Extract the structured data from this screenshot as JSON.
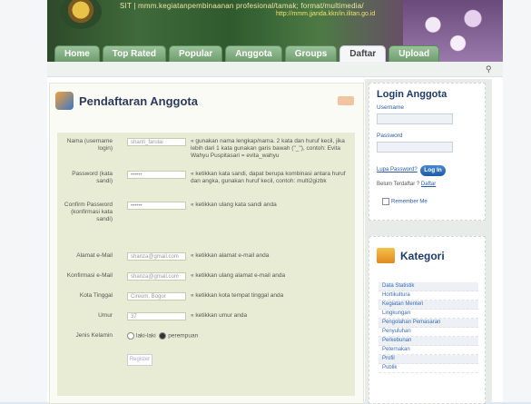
{
  "header": {
    "title": "SIT | mmm.kegiatanpembinaanan profesional/tamak; format/multimedia/",
    "url": "http://mmm.jjanda.kkn/in.ilitan.go.id"
  },
  "tabs": [
    "Home",
    "Top Rated",
    "Popular",
    "Anggota",
    "Groups",
    "Daftar",
    "Upload"
  ],
  "active_tab": "Daftar",
  "main": {
    "title": "Pendaftaran Anggota",
    "form": [
      {
        "label": "Nama (username login)",
        "value": "shanti_farulai",
        "hint": "« gunakan nama lengkap/nama. 2 kata dan huruf kecil, jika lebih dari 1 kata gunakan garis bawah (\"_\"), contoh: Evita Wahyu Puspitasari = evita_wahyu"
      },
      {
        "label": "Password (kata sandi)",
        "value": "••••••",
        "hint": "« ketikkan kata sandi, dapat berupa kombinasi antara huruf dan angka, gunakan huruf kecil, contoh: multi2gizbk"
      },
      {
        "label": "Confirm Password (konfirmasi kata sandi)",
        "value": "••••••",
        "hint": "« ketikkan ulang kata sandi anda"
      },
      {
        "label": "Alamat e-Mail",
        "value": "shanza@gmail.com",
        "hint": "« ketikkan alamat e-mail anda"
      },
      {
        "label": "Konfirmasi e-Mail",
        "value": "shanza@gmail.com",
        "hint": "« ketikkan ulang alamat e-mail anda"
      },
      {
        "label": "Kota Tinggal",
        "value": "Cireum, Bogor",
        "hint": "« ketikkan kota tempat tinggal anda"
      },
      {
        "label": "Umur",
        "value": "37",
        "hint": "« ketikkan umur anda"
      }
    ],
    "gender_label": "Jenis Kelamin",
    "gender_options": [
      "laki-laki",
      "perempuan"
    ],
    "submit_label": "Register"
  },
  "login": {
    "title": "Login Anggota",
    "username_label": "Username",
    "password_label": "Password",
    "lost_password": "Lupa Password?",
    "login_button": "Log In",
    "not_registered": "Belum Terdaftar ?",
    "register_link": "Daftar",
    "remember": "Remember Me"
  },
  "kategori": {
    "title": "Kategori",
    "items": [
      "Data Statistik",
      "Hortikultura",
      "Kegiatan Menteri",
      "Lingkungan",
      "Pengolahan Pemasaran",
      "Penyuluhan",
      "Perkebunan",
      "Peternakan",
      "Profil",
      "Publik"
    ]
  }
}
